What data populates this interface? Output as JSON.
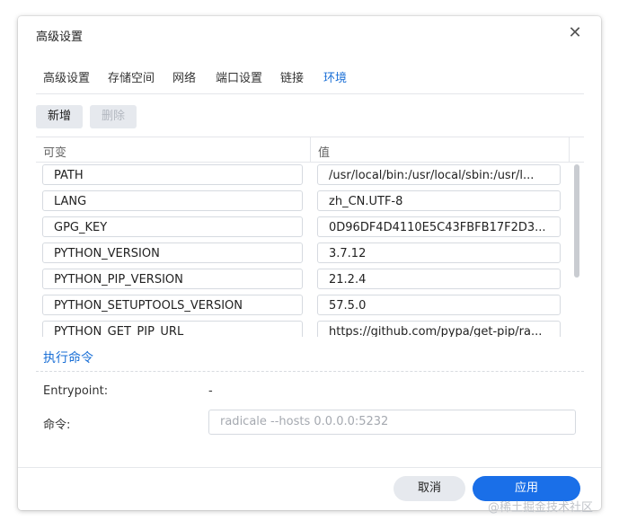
{
  "dialog": {
    "title": "高级设置",
    "close_glyph": "✕"
  },
  "tabs": [
    {
      "label": "高级设置"
    },
    {
      "label": "存储空间"
    },
    {
      "label": "网络"
    },
    {
      "label": "端口设置"
    },
    {
      "label": "链接"
    },
    {
      "label": "环境",
      "active": true
    }
  ],
  "toolbar": {
    "add_label": "新增",
    "delete_label": "删除"
  },
  "table": {
    "headers": [
      "可变",
      "值"
    ],
    "rows": [
      {
        "key": "PATH",
        "value": "/usr/local/bin:/usr/local/sbin:/usr/l..."
      },
      {
        "key": "LANG",
        "value": "zh_CN.UTF-8"
      },
      {
        "key": "GPG_KEY",
        "value": "0D96DF4D4110E5C43FBFB17F2D3..."
      },
      {
        "key": "PYTHON_VERSION",
        "value": "3.7.12"
      },
      {
        "key": "PYTHON_PIP_VERSION",
        "value": "21.2.4"
      },
      {
        "key": "PYTHON_SETUPTOOLS_VERSION",
        "value": "57.5.0"
      },
      {
        "key": "PYTHON_GET_PIP_URL",
        "value": "https://github.com/pypa/get-pip/ra..."
      }
    ]
  },
  "command_section": {
    "title": "执行命令",
    "entrypoint_label": "Entrypoint:",
    "entrypoint_value": "-",
    "command_label": "命令:",
    "command_placeholder": "radicale --hosts 0.0.0.0:5232"
  },
  "footer": {
    "cancel_label": "取消",
    "apply_label": "应用"
  },
  "watermark": "@稀土掘金技术社区",
  "colors": {
    "accent": "#1a6fd6",
    "primary_button": "#1a6fe8",
    "secondary_button": "#e6e9ee"
  }
}
